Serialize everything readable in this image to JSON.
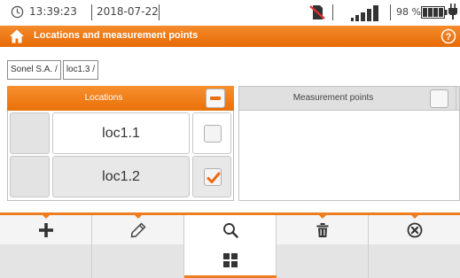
{
  "status": {
    "time": "13:39:23",
    "date": "2018-07-22",
    "battery_percent": "98 %",
    "icons": [
      "clock-icon",
      "no-sd-card-icon",
      "signal-strength-icon",
      "battery-icon",
      "plug-icon"
    ]
  },
  "header": {
    "title": "Locations and measurement points",
    "icons": [
      "home-icon",
      "help-icon"
    ]
  },
  "breadcrumb": [
    "Sonel S.A. /",
    "loc1.3 /"
  ],
  "locations": {
    "header": "Locations",
    "items": [
      {
        "name": "loc1.1",
        "checked": false
      },
      {
        "name": "loc1.2",
        "checked": true
      }
    ]
  },
  "measurement_points": {
    "header": "Measurement points",
    "items": []
  },
  "toolbar": {
    "buttons": [
      "add-icon",
      "edit-icon",
      "search-icon",
      "delete-icon",
      "close-icon"
    ],
    "secondary": [
      "",
      "",
      "grid-view-icon",
      "",
      ""
    ],
    "active_index": 2
  },
  "colors": {
    "accent": "#ef7d1f",
    "header_gradient_top": "#f58b2c",
    "header_gradient_bottom": "#e66a05",
    "panel_grey": "#e0e0e0",
    "check_mark": "#ea6a12"
  }
}
